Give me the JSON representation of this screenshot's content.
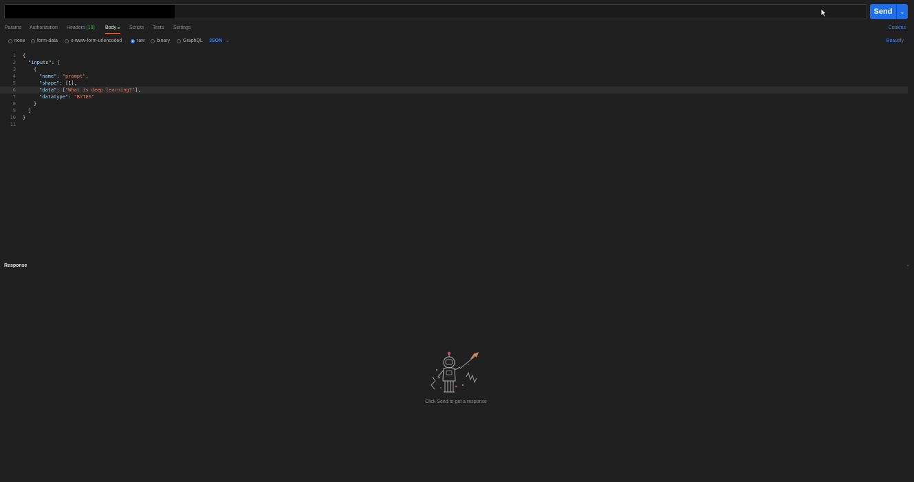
{
  "request": {
    "url_value": "",
    "send_label": "Send"
  },
  "tabs": {
    "params": "Params",
    "authorization": "Authorization",
    "headers": "Headers",
    "headers_count": "(10)",
    "body": "Body",
    "scripts": "Scripts",
    "tests": "Tests",
    "settings": "Settings",
    "cookies": "Cookies"
  },
  "body_options": {
    "none": "none",
    "form_data": "form-data",
    "urlencoded": "x-www-form-urlencoded",
    "raw": "raw",
    "binary": "binary",
    "graphql": "GraphQL",
    "format": "JSON",
    "beautify": "Beautify",
    "selected": "raw"
  },
  "editor": {
    "line_numbers": [
      "1",
      "2",
      "3",
      "4",
      "5",
      "6",
      "7",
      "8",
      "9",
      "10",
      "11"
    ],
    "highlighted_line": 6
  },
  "response": {
    "title": "Response",
    "empty_text": "Click Send to get a response"
  },
  "colors": {
    "accent": "#1f6feb",
    "link": "#3b82f6",
    "tab_underline": "#f26b3a",
    "string": "#d7826a",
    "key": "#9cdcfe"
  }
}
